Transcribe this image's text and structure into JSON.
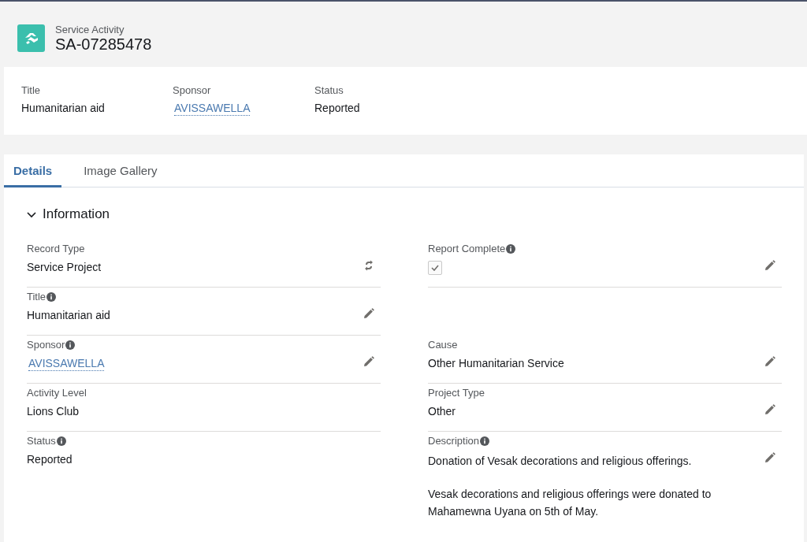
{
  "header": {
    "object_type": "Service Activity",
    "record_name": "SA-07285478"
  },
  "highlights": [
    {
      "label": "Title",
      "value": "Humanitarian aid",
      "kind": "text"
    },
    {
      "label": "Sponsor",
      "value": "AVISSAWELLA",
      "kind": "link"
    },
    {
      "label": "Status",
      "value": "Reported",
      "kind": "text"
    }
  ],
  "tabs": [
    {
      "label": "Details",
      "selected": true
    },
    {
      "label": "Image Gallery",
      "selected": false
    }
  ],
  "section": {
    "title": "Information",
    "expanded": true,
    "rows": [
      {
        "left": {
          "label": "Record Type",
          "info": false,
          "kind": "text",
          "value": "Service Project",
          "editable": false,
          "changeable": true
        },
        "right": {
          "label": "Report Complete",
          "info": true,
          "kind": "checkbox",
          "checked": true,
          "editable": true,
          "changeable": false
        }
      },
      {
        "left": {
          "label": "Title",
          "info": true,
          "kind": "text",
          "value": "Humanitarian aid",
          "editable": true,
          "changeable": false
        }
      },
      {
        "left": {
          "label": "Sponsor",
          "info": true,
          "kind": "link",
          "value": "AVISSAWELLA",
          "editable": true,
          "changeable": false
        },
        "right": {
          "label": "Cause",
          "info": false,
          "kind": "text",
          "value": "Other Humanitarian Service",
          "editable": true,
          "changeable": false
        }
      },
      {
        "left": {
          "label": "Activity Level",
          "info": false,
          "kind": "text",
          "value": "Lions Club",
          "editable": false,
          "changeable": false
        },
        "right": {
          "label": "Project Type",
          "info": false,
          "kind": "text",
          "value": "Other",
          "editable": true,
          "changeable": false
        }
      },
      {
        "left": {
          "label": "Status",
          "info": true,
          "kind": "text",
          "value": "Reported",
          "editable": false,
          "changeable": false
        },
        "right": {
          "label": "Description",
          "info": true,
          "kind": "paragraphs",
          "paragraphs": [
            "Donation of Vesak decorations and religious offerings.",
            "Vesak decorations and religious offerings were donated to Mahamewna Uyana on 5th of May."
          ],
          "editable": true,
          "changeable": false
        }
      }
    ]
  }
}
